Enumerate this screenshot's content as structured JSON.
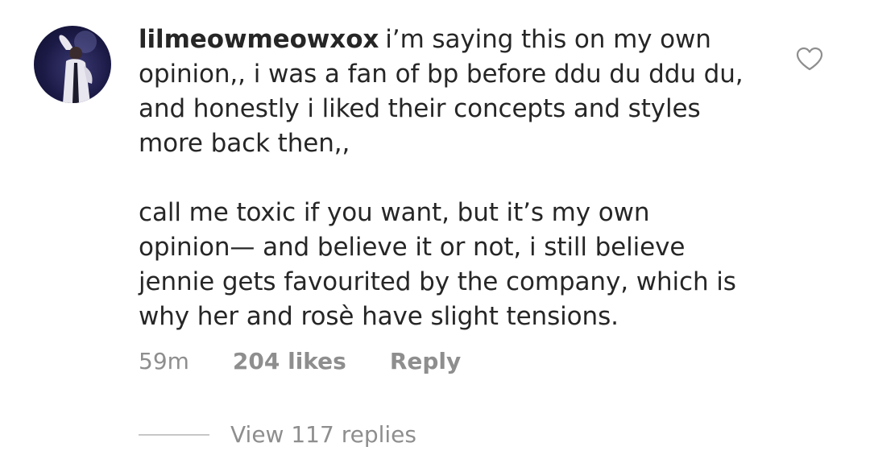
{
  "comment": {
    "avatar_icon": "user-photo-avatar",
    "username": "lilmeowmeowxox",
    "paragraph1": "i’m saying this on my own\nopinion,, i was a fan of bp before ddu du ddu du,\nand honestly i liked their concepts and styles\nmore back then,,",
    "paragraph2": "call me toxic if you want, but it’s my own\nopinion— and believe it or not, i still believe\njennie gets favourited by the company, which is\nwhy her and rosè have slight tensions.",
    "time": "59m",
    "likes": "204 likes",
    "reply_label": "Reply",
    "like_icon": "heart-outline-icon",
    "view_replies_label": "View 117 replies"
  },
  "colors": {
    "text": "#262626",
    "secondary": "#8e8e8e",
    "divider": "#c7c7c7"
  }
}
